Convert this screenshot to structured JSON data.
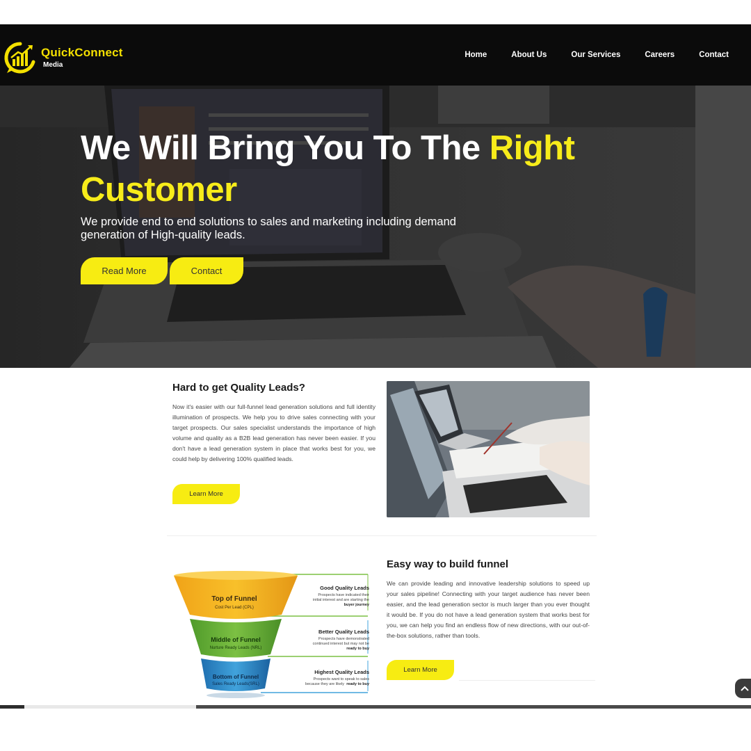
{
  "brand": {
    "name": "QuickConnect",
    "sub": "Media",
    "accent": "#f7ec12",
    "dark": "#0b0b0b"
  },
  "nav": {
    "items": [
      "Home",
      "About Us",
      "Our Services",
      "Careers",
      "Contact"
    ]
  },
  "hero": {
    "title_white": "We Will Bring You To The",
    "title_highlight": "Right Customer",
    "subtitle": "We provide end to end solutions to sales and marketing including demand generation of High-quality leads.",
    "read_more": "Read More",
    "contact": "Contact"
  },
  "section1": {
    "title": "Hard to get Quality Leads?",
    "text": "Now it's easier with our full-funnel lead generation solutions and full identity illumination of prospects. We help you to drive sales connecting with your target prospects. Our sales specialist understands the importance of high volume and quality as a B2B lead generation has never been easier. If you don't have a lead generation system in place that works best for you, we could help by delivering 100% qualified leads.",
    "button": "Learn More"
  },
  "funnel": {
    "top": {
      "label": "Top of Funnel",
      "sub": "Cost Per Lead (CPL)"
    },
    "middle": {
      "label": "Middle of Funnel",
      "sub": "Nurture Ready Leads (NRL)"
    },
    "bottom": {
      "label": "Bottom of Funnel",
      "sub": "Sales Ready Leads(SRL)"
    },
    "notes": [
      {
        "title": "Good Quality Leads",
        "l1": "Prospects have indicated their",
        "l2": "initial interest and are starting the",
        "l3": "buyer journey"
      },
      {
        "title": "Better Quality Leads",
        "l1": "Prospects have demonstrated",
        "l2": "continued interest but may not be",
        "l3": "ready to buy"
      },
      {
        "title": "Highest Quality Leads",
        "l1": "Prospects want to speak to sales",
        "l2": "because they are likely",
        "l3": "ready to buy"
      }
    ]
  },
  "section2": {
    "title": "Easy way to build funnel",
    "text": "We can provide leading and innovative leadership solutions to speed up your sales pipeline! Connecting with your target audience has never been easier, and the lead generation sector is much larger than you ever thought it would be. If you do not have a lead generation system that works best for you, we can help you find an endless flow of new directions, with our out-of-the-box solutions, rather than tools.",
    "button": "Learn More"
  },
  "icons": {
    "scroll_top": "chevron-up-icon"
  }
}
